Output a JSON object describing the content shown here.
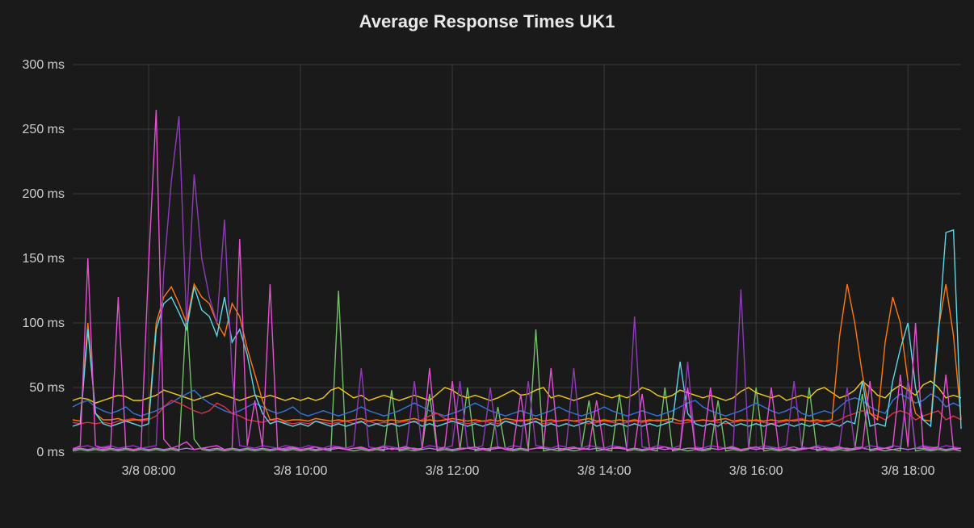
{
  "chart_data": {
    "type": "line",
    "title": "Average Response Times UK1",
    "ylabel": "",
    "xlabel": "",
    "ylim": [
      0,
      300
    ],
    "y_ticks": [
      0,
      50,
      100,
      150,
      200,
      250,
      300
    ],
    "y_tick_labels": [
      "0 ms",
      "50 ms",
      "100 ms",
      "150 ms",
      "200 ms",
      "250 ms",
      "300 ms"
    ],
    "x_ticks": [
      8,
      10,
      12,
      14,
      16,
      18
    ],
    "x_tick_labels": [
      "3/8 08:00",
      "3/8 10:00",
      "3/8 12:00",
      "3/8 14:00",
      "3/8 16:00",
      "3/8 18:00"
    ],
    "xlim": [
      7,
      18.7
    ],
    "x": [
      7.0,
      7.1,
      7.2,
      7.3,
      7.4,
      7.5,
      7.6,
      7.7,
      7.8,
      7.9,
      8.0,
      8.1,
      8.2,
      8.3,
      8.4,
      8.5,
      8.6,
      8.7,
      8.8,
      8.9,
      9.0,
      9.1,
      9.2,
      9.3,
      9.4,
      9.5,
      9.6,
      9.7,
      9.8,
      9.9,
      10.0,
      10.1,
      10.2,
      10.3,
      10.4,
      10.5,
      10.6,
      10.7,
      10.8,
      10.9,
      11.0,
      11.1,
      11.2,
      11.3,
      11.4,
      11.5,
      11.6,
      11.7,
      11.8,
      11.9,
      12.0,
      12.1,
      12.2,
      12.3,
      12.4,
      12.5,
      12.6,
      12.7,
      12.8,
      12.9,
      13.0,
      13.1,
      13.2,
      13.3,
      13.4,
      13.5,
      13.6,
      13.7,
      13.8,
      13.9,
      14.0,
      14.1,
      14.2,
      14.3,
      14.4,
      14.5,
      14.6,
      14.7,
      14.8,
      14.9,
      15.0,
      15.1,
      15.2,
      15.3,
      15.4,
      15.5,
      15.6,
      15.7,
      15.8,
      15.9,
      16.0,
      16.1,
      16.2,
      16.3,
      16.4,
      16.5,
      16.6,
      16.7,
      16.8,
      16.9,
      17.0,
      17.1,
      17.2,
      17.3,
      17.4,
      17.5,
      17.6,
      17.7,
      17.8,
      17.9,
      18.0,
      18.1,
      18.2,
      18.3,
      18.4,
      18.5,
      18.6,
      18.7
    ],
    "series": [
      {
        "name": "series-yellow",
        "color": "#F2CC0C",
        "values": [
          40,
          42,
          41,
          38,
          40,
          42,
          44,
          43,
          40,
          40,
          42,
          44,
          48,
          46,
          44,
          42,
          40,
          42,
          44,
          46,
          44,
          42,
          40,
          42,
          44,
          42,
          44,
          42,
          40,
          42,
          40,
          42,
          40,
          42,
          48,
          50,
          46,
          42,
          44,
          40,
          42,
          44,
          42,
          40,
          42,
          44,
          42,
          40,
          45,
          50,
          48,
          44,
          42,
          44,
          42,
          40,
          42,
          45,
          48,
          44,
          45,
          48,
          50,
          42,
          44,
          42,
          40,
          42,
          44,
          46,
          44,
          42,
          44,
          42,
          45,
          50,
          48,
          44,
          42,
          44,
          48,
          46,
          44,
          42,
          44,
          42,
          40,
          42,
          47,
          50,
          46,
          44,
          42,
          44,
          40,
          42,
          44,
          42,
          48,
          50,
          46,
          42,
          44,
          48,
          55,
          50,
          44,
          42,
          48,
          52,
          48,
          44,
          52,
          55,
          50,
          42,
          44,
          42
        ]
      },
      {
        "name": "series-blue",
        "color": "#3274D9",
        "values": [
          35,
          38,
          40,
          35,
          32,
          30,
          32,
          35,
          30,
          28,
          30,
          32,
          35,
          38,
          42,
          45,
          48,
          42,
          38,
          35,
          32,
          30,
          32,
          35,
          38,
          35,
          32,
          30,
          32,
          35,
          30,
          28,
          30,
          32,
          30,
          28,
          30,
          32,
          35,
          32,
          30,
          28,
          30,
          32,
          35,
          38,
          35,
          32,
          30,
          28,
          30,
          32,
          35,
          38,
          35,
          32,
          30,
          28,
          30,
          32,
          30,
          28,
          30,
          32,
          35,
          32,
          30,
          28,
          30,
          32,
          35,
          32,
          30,
          28,
          30,
          32,
          30,
          28,
          30,
          32,
          35,
          38,
          40,
          35,
          32,
          30,
          28,
          30,
          32,
          35,
          38,
          35,
          32,
          30,
          32,
          35,
          30,
          28,
          30,
          32,
          30,
          35,
          40,
          42,
          40,
          35,
          32,
          30,
          40,
          45,
          42,
          38,
          40,
          45,
          42,
          35,
          38,
          35
        ]
      },
      {
        "name": "series-red",
        "color": "#E02F44",
        "values": [
          23,
          22,
          23,
          22,
          23,
          22,
          24,
          25,
          26,
          24,
          25,
          28,
          35,
          40,
          38,
          35,
          32,
          30,
          32,
          38,
          35,
          30,
          28,
          25,
          24,
          23,
          25,
          24,
          23,
          22,
          23,
          22,
          24,
          23,
          22,
          23,
          24,
          22,
          23,
          24,
          22,
          23,
          22,
          23,
          24,
          23,
          25,
          28,
          30,
          26,
          24,
          23,
          22,
          23,
          24,
          23,
          22,
          24,
          23,
          25,
          24,
          23,
          22,
          23,
          24,
          25,
          24,
          23,
          22,
          23,
          24,
          23,
          22,
          23,
          24,
          23,
          24,
          25,
          24,
          23,
          22,
          23,
          24,
          25,
          24,
          23,
          22,
          23,
          24,
          25,
          24,
          23,
          22,
          23,
          24,
          25,
          26,
          24,
          23,
          24,
          23,
          25,
          28,
          30,
          32,
          30,
          28,
          25,
          30,
          32,
          30,
          25,
          28,
          30,
          32,
          25,
          28,
          25
        ]
      },
      {
        "name": "series-orange",
        "color": "#FF780A",
        "values": [
          25,
          24,
          100,
          30,
          25,
          25,
          26,
          24,
          25,
          25,
          26,
          100,
          120,
          128,
          115,
          100,
          130,
          120,
          115,
          100,
          90,
          115,
          105,
          80,
          60,
          40,
          25,
          26,
          24,
          25,
          25,
          24,
          26,
          25,
          24,
          25,
          24,
          25,
          26,
          24,
          25,
          24,
          25,
          24,
          25,
          26,
          24,
          25,
          24,
          25,
          26,
          25,
          24,
          25,
          24,
          25,
          24,
          26,
          25,
          24,
          25,
          26,
          24,
          25,
          24,
          25,
          24,
          25,
          26,
          24,
          25,
          24,
          25,
          24,
          25,
          24,
          25,
          24,
          25,
          26,
          24,
          25,
          24,
          25,
          24,
          25,
          26,
          24,
          25,
          24,
          25,
          24,
          25,
          24,
          25,
          24,
          25,
          24,
          25,
          24,
          25,
          90,
          130,
          100,
          60,
          30,
          25,
          85,
          120,
          100,
          55,
          30,
          25,
          24,
          95,
          130,
          90,
          25
        ]
      },
      {
        "name": "series-cyan",
        "color": "#5AD8E6",
        "values": [
          20,
          22,
          95,
          30,
          22,
          20,
          22,
          24,
          22,
          20,
          22,
          95,
          115,
          120,
          108,
          95,
          128,
          110,
          105,
          90,
          120,
          85,
          95,
          75,
          45,
          30,
          22,
          24,
          22,
          20,
          22,
          20,
          24,
          22,
          20,
          22,
          20,
          22,
          24,
          20,
          22,
          20,
          22,
          20,
          22,
          24,
          20,
          22,
          20,
          22,
          24,
          22,
          20,
          22,
          20,
          22,
          20,
          24,
          22,
          20,
          22,
          24,
          20,
          22,
          20,
          22,
          20,
          22,
          24,
          20,
          22,
          20,
          22,
          20,
          22,
          20,
          22,
          20,
          22,
          24,
          70,
          30,
          22,
          20,
          22,
          20,
          24,
          20,
          22,
          20,
          22,
          20,
          22,
          20,
          22,
          20,
          22,
          20,
          22,
          20,
          22,
          20,
          24,
          22,
          55,
          20,
          22,
          20,
          55,
          80,
          100,
          50,
          25,
          20,
          90,
          170,
          172,
          18
        ]
      },
      {
        "name": "series-magenta",
        "color": "#E54FD4",
        "values": [
          2,
          5,
          150,
          5,
          3,
          4,
          120,
          3,
          2,
          3,
          145,
          265,
          10,
          3,
          5,
          8,
          2,
          3,
          4,
          5,
          2,
          3,
          165,
          5,
          40,
          4,
          130,
          2,
          3,
          4,
          2,
          3,
          4,
          2,
          3,
          4,
          2,
          3,
          4,
          2,
          3,
          4,
          2,
          3,
          4,
          2,
          3,
          65,
          2,
          4,
          55,
          2,
          3,
          4,
          2,
          3,
          4,
          2,
          3,
          45,
          2,
          3,
          4,
          65,
          2,
          3,
          4,
          2,
          3,
          40,
          2,
          3,
          4,
          2,
          3,
          45,
          2,
          3,
          4,
          2,
          3,
          50,
          2,
          3,
          50,
          2,
          3,
          4,
          2,
          3,
          4,
          2,
          50,
          2,
          3,
          4,
          2,
          3,
          4,
          2,
          3,
          4,
          2,
          3,
          4,
          55,
          2,
          3,
          4,
          60,
          4,
          100,
          4,
          3,
          4,
          60,
          2,
          3
        ]
      },
      {
        "name": "series-purple",
        "color": "#8F3BB8",
        "values": [
          3,
          4,
          5,
          3,
          4,
          5,
          3,
          4,
          5,
          3,
          4,
          5,
          140,
          210,
          260,
          100,
          215,
          150,
          120,
          100,
          180,
          60,
          5,
          4,
          3,
          5,
          4,
          3,
          5,
          4,
          3,
          5,
          4,
          3,
          5,
          4,
          3,
          5,
          65,
          4,
          3,
          5,
          4,
          3,
          5,
          55,
          3,
          5,
          4,
          3,
          5,
          55,
          4,
          3,
          5,
          50,
          4,
          3,
          5,
          4,
          55,
          5,
          4,
          3,
          5,
          4,
          65,
          3,
          5,
          4,
          3,
          5,
          4,
          3,
          105,
          4,
          3,
          5,
          4,
          3,
          5,
          70,
          4,
          3,
          5,
          4,
          3,
          5,
          126,
          4,
          3,
          5,
          4,
          3,
          5,
          55,
          4,
          3,
          5,
          4,
          3,
          5,
          50,
          4,
          3,
          5,
          4,
          3,
          5,
          4,
          55,
          3,
          5,
          4,
          3,
          5,
          4,
          3
        ]
      },
      {
        "name": "series-green",
        "color": "#73BF69",
        "values": [
          1,
          2,
          1,
          2,
          1,
          2,
          1,
          2,
          1,
          2,
          1,
          2,
          1,
          2,
          1,
          110,
          10,
          2,
          1,
          2,
          1,
          2,
          1,
          2,
          1,
          2,
          1,
          2,
          1,
          2,
          1,
          2,
          1,
          2,
          1,
          125,
          2,
          1,
          2,
          1,
          2,
          1,
          48,
          1,
          2,
          1,
          2,
          45,
          1,
          2,
          1,
          2,
          50,
          1,
          2,
          1,
          35,
          2,
          1,
          2,
          1,
          95,
          1,
          2,
          1,
          2,
          1,
          2,
          40,
          1,
          2,
          1,
          45,
          1,
          2,
          1,
          2,
          1,
          50,
          1,
          2,
          1,
          2,
          1,
          2,
          40,
          1,
          2,
          1,
          2,
          50,
          1,
          2,
          1,
          2,
          1,
          2,
          50,
          1,
          2,
          1,
          2,
          1,
          2,
          45,
          1,
          2,
          1,
          2,
          1,
          55,
          1,
          2,
          1,
          2,
          1,
          2,
          1
        ]
      },
      {
        "name": "series-violet",
        "color": "#B877D9",
        "values": [
          2,
          3,
          2,
          3,
          2,
          3,
          2,
          3,
          2,
          3,
          2,
          3,
          2,
          3,
          2,
          3,
          2,
          3,
          2,
          3,
          2,
          3,
          2,
          3,
          2,
          3,
          2,
          3,
          2,
          3,
          2,
          3,
          2,
          3,
          2,
          3,
          2,
          3,
          3,
          2,
          3,
          2,
          3,
          2,
          3,
          3,
          2,
          3,
          2,
          3,
          2,
          3,
          3,
          2,
          3,
          2,
          3,
          3,
          2,
          3,
          2,
          3,
          3,
          2,
          3,
          2,
          3,
          3,
          2,
          3,
          2,
          3,
          3,
          2,
          3,
          2,
          3,
          3,
          2,
          3,
          2,
          3,
          3,
          2,
          3,
          2,
          3,
          3,
          2,
          3,
          2,
          3,
          3,
          2,
          3,
          2,
          3,
          3,
          2,
          3,
          2,
          3,
          3,
          2,
          3,
          2,
          3,
          3,
          2,
          3,
          2,
          3,
          3,
          2,
          3,
          2,
          3,
          3
        ]
      }
    ]
  }
}
